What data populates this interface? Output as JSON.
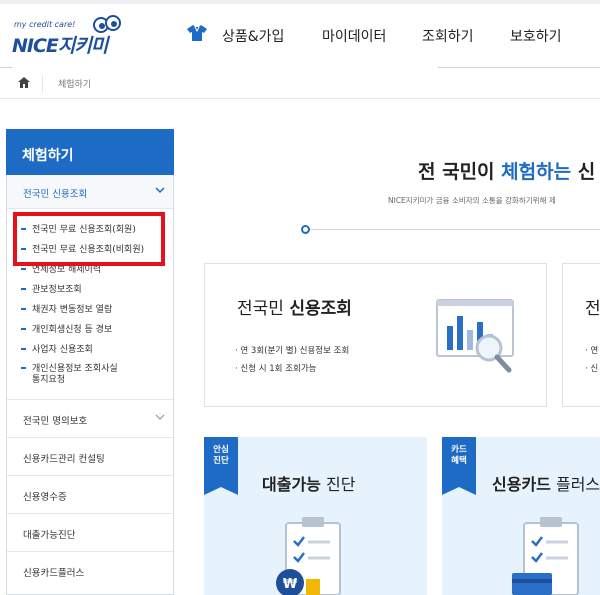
{
  "header": {
    "logo_tagline": "my credit care!",
    "logo_brand_en": "NICE",
    "logo_brand_ko": "지키미",
    "nav": [
      "상품&가입",
      "마이데이터",
      "조회하기",
      "보호하기"
    ]
  },
  "breadcrumb": {
    "current": "체험하기"
  },
  "sidebar": {
    "title": "체험하기",
    "section_open": "전국민 신용조회",
    "sub_items": [
      "전국민 무료 신용조회(회원)",
      "전국민 무료 신용조회(비회원)",
      "연체정보 해제이력",
      "관보정보조회",
      "채권자 변동정보 열람",
      "개인회생신청 등 경보",
      "사업자 신용조회",
      "개인신용정보 조회사실",
      "통지요청"
    ],
    "menu": [
      "전국민 명의보호",
      "신용카드관리 컨설팅",
      "신용영수증",
      "대출가능진단",
      "신용카드플러스"
    ]
  },
  "main": {
    "hero_prefix": "전 국민이 ",
    "hero_highlight": "체험하는",
    "hero_suffix": " 신",
    "hero_sub": "NICE지키미가 금융 소비자의 소통을 강화하기위해 제",
    "card1": {
      "title_prefix": "전국민 ",
      "title_bold": "신용조회",
      "lines": [
        "· 연 3회(분기 별) 신용정보 조회",
        "· 신청 시 1회 조회가능"
      ]
    },
    "card2": {
      "title": "전",
      "lines": [
        "· 연",
        "· 신"
      ]
    },
    "promo1": {
      "badge_line1": "안심",
      "badge_line2": "진단",
      "title_bold": "대출가능",
      "title_rest": " 진단"
    },
    "promo2": {
      "badge_line1": "카드",
      "badge_line2": "혜택",
      "title_bold": "신용카드",
      "title_rest": " 플러스"
    }
  },
  "colors": {
    "accent": "#1d6bc4",
    "highlight_box": "#e8111b",
    "promo_bg": "#e6f3fc"
  }
}
